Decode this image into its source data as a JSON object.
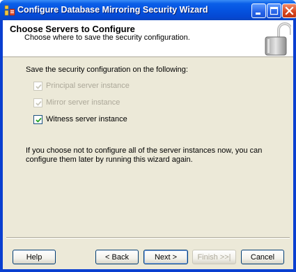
{
  "window": {
    "title": "Configure Database Mirroring Security Wizard"
  },
  "header": {
    "title": "Choose Servers to Configure",
    "subtitle": "Choose where to save the security configuration."
  },
  "content": {
    "intro": "Save the security configuration on the following:",
    "options": [
      {
        "label": "Principal server instance",
        "checked": true,
        "enabled": false
      },
      {
        "label": "Mirror server instance",
        "checked": true,
        "enabled": false
      },
      {
        "label": "Witness server instance",
        "checked": true,
        "enabled": true
      }
    ],
    "note": "If you choose not to configure all of the server instances now, you can configure them later by running this wizard again."
  },
  "buttons": {
    "help": "Help",
    "back": "< Back",
    "next": "Next >",
    "finish": "Finish >>|",
    "cancel": "Cancel"
  },
  "colors": {
    "titlebar": "#0553e0",
    "dialog_face": "#ece9d8",
    "disabled_text": "#aca899",
    "checkmark": "#21a121"
  }
}
